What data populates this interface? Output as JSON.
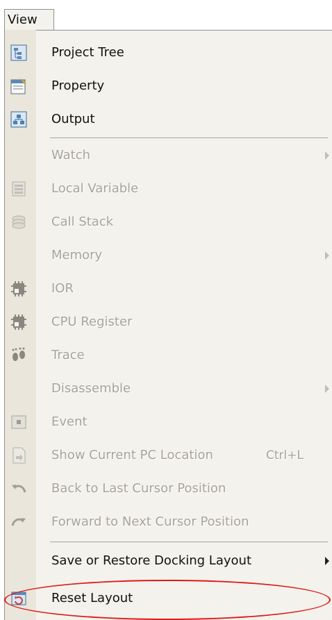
{
  "menubar": {
    "view_label": "View"
  },
  "colors": {
    "accent": "#dc1a1a",
    "menu_bg": "#f4f2ec",
    "gutter_bg": "#eae6db",
    "disabled_text": "#a8a49a"
  },
  "menu": {
    "items": [
      {
        "label": "Project Tree",
        "icon": "project-tree-icon",
        "enabled": true
      },
      {
        "label": "Property",
        "icon": "property-icon",
        "enabled": true
      },
      {
        "label": "Output",
        "icon": "output-icon",
        "enabled": true
      },
      {
        "label": "Watch",
        "icon": "",
        "enabled": false,
        "submenu": true
      },
      {
        "label": "Local Variable",
        "icon": "local-variable-icon",
        "enabled": false
      },
      {
        "label": "Call Stack",
        "icon": "call-stack-icon",
        "enabled": false
      },
      {
        "label": "Memory",
        "icon": "",
        "enabled": false,
        "submenu": true
      },
      {
        "label": "IOR",
        "icon": "ior-icon",
        "enabled": false
      },
      {
        "label": "CPU Register",
        "icon": "cpu-register-icon",
        "enabled": false
      },
      {
        "label": "Trace",
        "icon": "trace-icon",
        "enabled": false
      },
      {
        "label": "Disassemble",
        "icon": "",
        "enabled": false,
        "submenu": true
      },
      {
        "label": "Event",
        "icon": "event-icon",
        "enabled": false
      },
      {
        "label": "Show Current PC Location",
        "shortcut": "Ctrl+L",
        "icon": "show-pc-icon",
        "enabled": false
      },
      {
        "label": "Back to Last Cursor Position",
        "icon": "back-arrow-icon",
        "enabled": false
      },
      {
        "label": "Forward to Next Cursor Position",
        "icon": "forward-arrow-icon",
        "enabled": false
      },
      {
        "label": "Save or Restore Docking Layout",
        "icon": "",
        "enabled": true,
        "submenu": true
      },
      {
        "label": "Reset Layout",
        "icon": "reset-layout-icon",
        "enabled": true
      }
    ]
  }
}
